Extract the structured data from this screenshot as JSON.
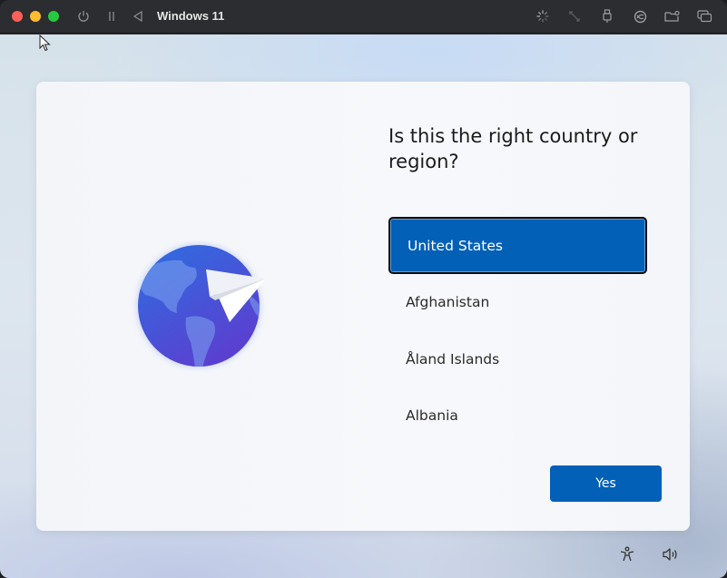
{
  "titlebar": {
    "title": "Windows 11",
    "left_icons": [
      "power-icon",
      "pause-icon",
      "back-icon"
    ],
    "right_icons": [
      "loading-icon",
      "resize-icon",
      "usb-icon",
      "network-icon",
      "shared-folder-icon",
      "windows-icon"
    ]
  },
  "oobe": {
    "heading": "Is this the right country or region?",
    "countries": [
      {
        "label": "United States",
        "selected": true
      },
      {
        "label": "Afghanistan",
        "selected": false
      },
      {
        "label": "Åland Islands",
        "selected": false
      },
      {
        "label": "Albania",
        "selected": false
      }
    ],
    "yes_label": "Yes"
  },
  "colors": {
    "accent": "#0260b7",
    "globe_top": "#2d6fe0",
    "globe_bottom": "#5b3fd0"
  },
  "footer_icons": [
    "accessibility-icon",
    "volume-icon"
  ]
}
